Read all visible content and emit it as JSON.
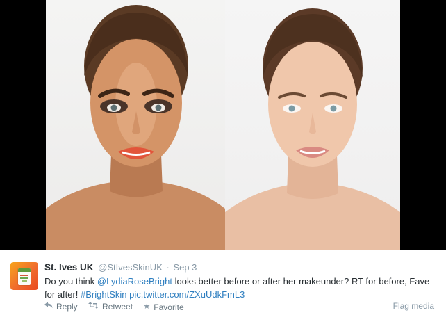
{
  "tweet": {
    "fullname": "St. Ives UK",
    "username": "@StIvesSkinUK",
    "separator": "·",
    "time": "Sep 3",
    "text_parts": {
      "p1": "Do you think ",
      "mention": "@LydiaRoseBright",
      "p2": " looks better before or after her makeunder? RT for before, Fave for after! ",
      "hashtag": "#BrightSkin",
      "p3": " ",
      "link": "pic.twitter.com/ZXuUdkFmL3"
    },
    "actions": {
      "reply": "Reply",
      "retweet": "Retweet",
      "favorite": "Favorite"
    },
    "flag": "Flag media"
  },
  "icons": {
    "reply": "reply-icon",
    "retweet": "retweet-icon",
    "favorite": "star-icon"
  },
  "colors": {
    "link": "#2f7fc0",
    "muted": "#8899a6",
    "text": "#292f33",
    "brand_orange": "#f06b2d"
  }
}
